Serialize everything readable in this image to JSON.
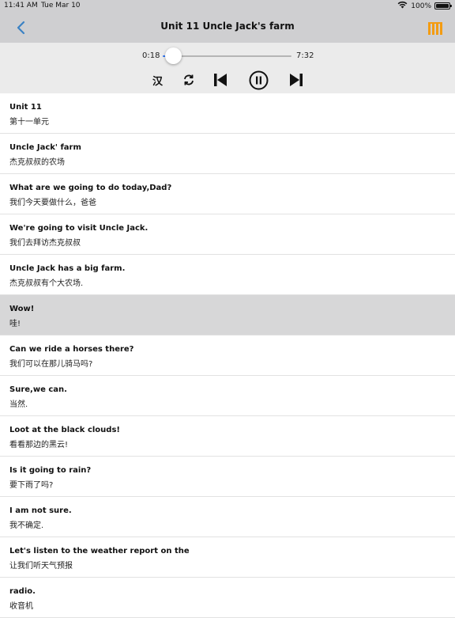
{
  "status_bar": {
    "time": "11:41 AM",
    "date": "Tue Mar 10",
    "battery": "100%",
    "battery_level": 1.0,
    "wifi_icon": "wifi-icon"
  },
  "nav": {
    "title": "Unit 11 Uncle Jack's farm",
    "back_icon": "chevron-left-icon",
    "right_icon": "library-bars-icon",
    "accent_color": "#3b82c4",
    "right_icon_color": "#f39c12"
  },
  "player": {
    "current_time": "0:18",
    "total_time": "7:32",
    "progress": 0.04,
    "han_label": "汉",
    "controls": [
      "repeat-icon",
      "skip-previous-icon",
      "pause-icon",
      "skip-next-icon"
    ],
    "progress_color": "#3478f6"
  },
  "lines": [
    {
      "en": "Unit 11",
      "zh": "第十一单元"
    },
    {
      "en": "Uncle Jack' farm",
      "zh": "杰克叔叔的农场"
    },
    {
      "en": "What are we going to do today,Dad?",
      "zh": "我们今天要做什么，爸爸"
    },
    {
      "en": "We're going to visit Uncle Jack.",
      "zh": "我们去拜访杰克叔叔"
    },
    {
      "en": "Uncle Jack has a big farm.",
      "zh": "杰克叔叔有个大农场."
    },
    {
      "en": "Wow!",
      "zh": "哇!"
    },
    {
      "en": "Can we ride a horses there?",
      "zh": "我们可以在那儿骑马吗?"
    },
    {
      "en": "Sure,we can.",
      "zh": "当然."
    },
    {
      "en": "Loot at the black clouds!",
      "zh": "看看那边的黑云!"
    },
    {
      "en": "Is it going to rain?",
      "zh": "要下雨了吗?"
    },
    {
      "en": "I am not sure.",
      "zh": "我不确定."
    },
    {
      "en": "Let's listen to the weather report on the",
      "zh": "让我们听天气预报"
    },
    {
      "en": "radio.",
      "zh": "收音机"
    }
  ],
  "selected_index": 5
}
